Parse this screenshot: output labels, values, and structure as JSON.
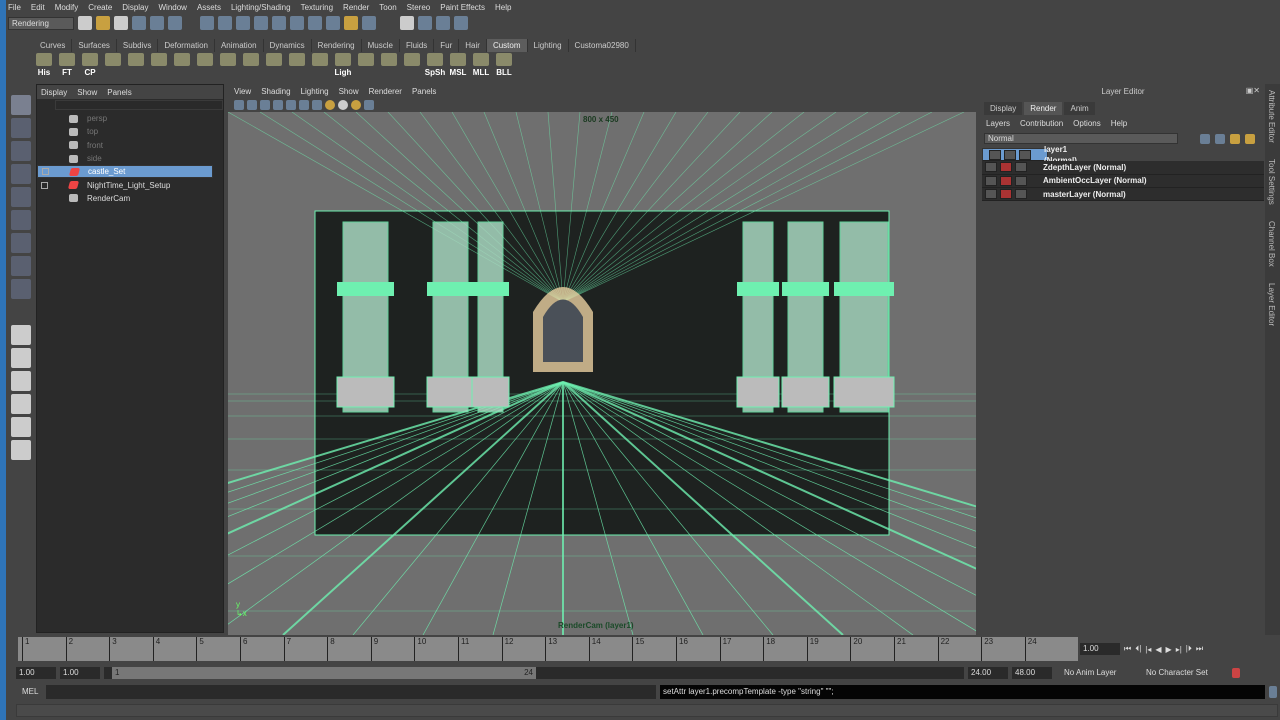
{
  "menubar": [
    "File",
    "Edit",
    "Modify",
    "Create",
    "Display",
    "Window",
    "Assets",
    "Lighting/Shading",
    "Texturing",
    "Render",
    "Toon",
    "Stereo",
    "Paint Effects",
    "Help"
  ],
  "status": {
    "menuset": "Rendering"
  },
  "shelf_tabs": [
    "Curves",
    "Surfaces",
    "Subdivs",
    "Deformation",
    "Animation",
    "Dynamics",
    "Rendering",
    "Muscle",
    "Fluids",
    "Fur",
    "Hair",
    "Custom",
    "Lighting",
    "Customa02980"
  ],
  "active_shelf": "Custom",
  "shelf_labels": [
    "His",
    "FT",
    "CP",
    "",
    "",
    "",
    "",
    "",
    "",
    "",
    "",
    "",
    "",
    "Ligh",
    "",
    "",
    "",
    "SpSh",
    "MSL",
    "MLL",
    "BLL"
  ],
  "outliner": {
    "menu": [
      "Display",
      "Show",
      "Panels"
    ],
    "items": [
      {
        "label": "persp",
        "dim": true
      },
      {
        "label": "top",
        "dim": true
      },
      {
        "label": "front",
        "dim": true
      },
      {
        "label": "side",
        "dim": true
      },
      {
        "label": "castle_Set",
        "selected": true,
        "set": true
      },
      {
        "label": "NightTime_Light_Setup",
        "set": true
      },
      {
        "label": "RenderCam"
      }
    ]
  },
  "viewport": {
    "menu": [
      "View",
      "Shading",
      "Lighting",
      "Show",
      "Renderer",
      "Panels"
    ],
    "resolution": "800 x 450",
    "camera_label": "RenderCam (layer1)",
    "wire_color": "#6ef0b0"
  },
  "layer_editor": {
    "title": "Layer Editor",
    "tabs": [
      "Display",
      "Render",
      "Anim"
    ],
    "active_tab": "Render",
    "menu": [
      "Layers",
      "Contribution",
      "Options",
      "Help"
    ],
    "blend_mode": "Normal",
    "layers": [
      {
        "name": "layer1 (Normal)",
        "selected": true
      },
      {
        "name": "ZdepthLayer (Normal)"
      },
      {
        "name": "AmbientOccLayer (Normal)"
      },
      {
        "name": "masterLayer (Normal)"
      }
    ]
  },
  "side_tabs": [
    "Attribute Editor",
    "Tool Settings",
    "Channel Box",
    "Layer Editor"
  ],
  "timeline": {
    "ticks": [
      "1",
      "2",
      "3",
      "4",
      "5",
      "6",
      "7",
      "8",
      "9",
      "10",
      "11",
      "12",
      "13",
      "14",
      "15",
      "16",
      "17",
      "18",
      "19",
      "20",
      "21",
      "22",
      "23",
      "24"
    ],
    "current": "1.00"
  },
  "range": {
    "start": "1.00",
    "start2": "1.00",
    "inner_start": "1",
    "inner_end": "24",
    "end": "24.00",
    "end2": "48.00",
    "anim_layer": "No Anim Layer",
    "char_set": "No Character Set"
  },
  "command": {
    "label": "MEL",
    "result": "setAttr layer1.precompTemplate -type \"string\" \"\";"
  }
}
